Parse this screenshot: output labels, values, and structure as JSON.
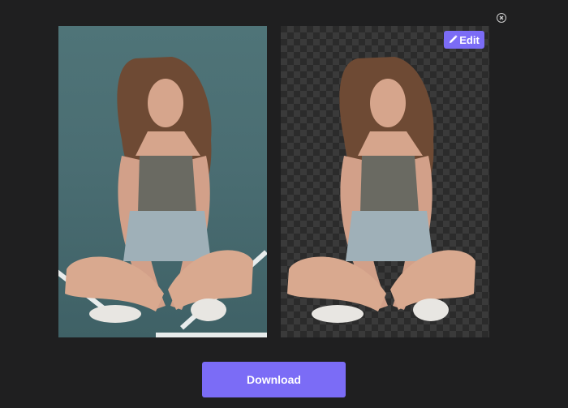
{
  "dialog": {
    "close_icon": "close-circle-icon"
  },
  "images": {
    "original": {
      "subject": "photo-subject"
    },
    "result": {
      "background": "transparent-checkerboard"
    }
  },
  "edit_button": {
    "label": "Edit",
    "icon": "pencil-icon"
  },
  "download_button": {
    "label": "Download"
  },
  "colors": {
    "background": "#1f1f20",
    "accent": "#7b6cf6",
    "text_on_accent": "#ffffff"
  }
}
